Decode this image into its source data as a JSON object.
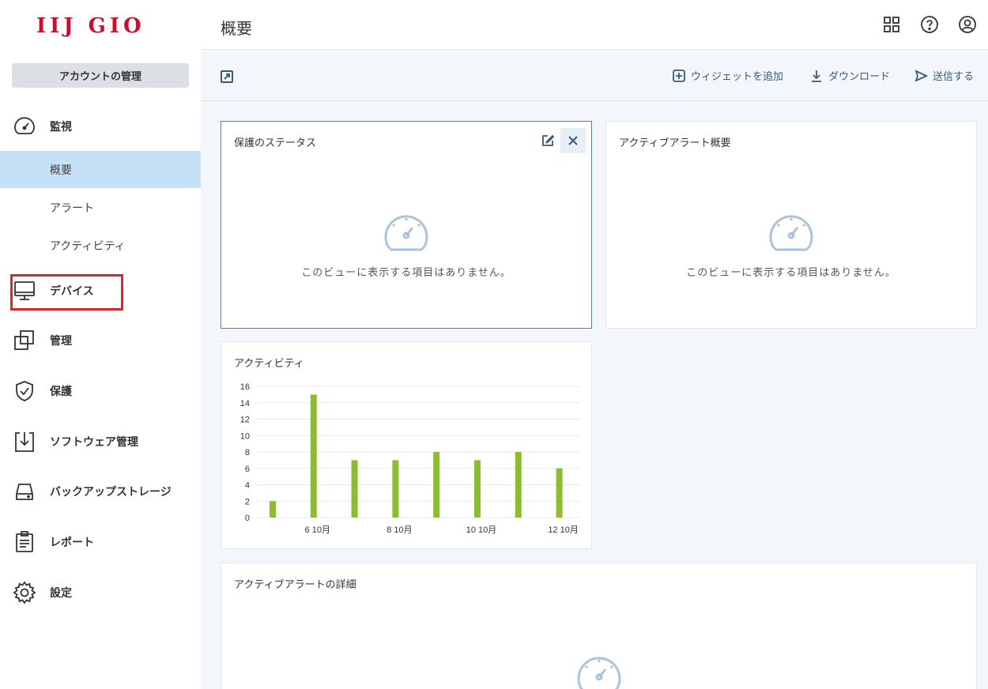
{
  "brand": {
    "logo": "IIJ GIO"
  },
  "sidebar": {
    "account_button": "アカウントの管理",
    "monitor": "監視",
    "sub_items": [
      "概要",
      "アラート",
      "アクティビティ"
    ],
    "devices": "デバイス",
    "management": "管理",
    "protection": "保護",
    "software": "ソフトウェア管理",
    "backup": "バックアップストレージ",
    "reports": "レポート",
    "settings": "設定"
  },
  "header": {
    "title": "概要"
  },
  "toolbar": {
    "add_widget": "ウィジェットを追加",
    "download": "ダウンロード",
    "send": "送信する"
  },
  "widgets": {
    "protection_status": {
      "title": "保護のステータス",
      "empty": "このビューに表示する項目はありません。"
    },
    "active_alerts_summary": {
      "title": "アクティブアラート概要",
      "empty": "このビューに表示する項目はありません。"
    },
    "activity": {
      "title": "アクティビティ"
    },
    "active_alerts_detail": {
      "title": "アクティブアラートの詳細"
    }
  },
  "colors": {
    "accent": "#8dbd2f",
    "highlight": "#d8262c",
    "active_bg": "#c5e1f5"
  },
  "chart_data": {
    "type": "bar",
    "categories": [
      "5",
      "6",
      "7",
      "8",
      "9",
      "10",
      "11",
      "12"
    ],
    "values": [
      2,
      15,
      7,
      7,
      8,
      7,
      8,
      6
    ],
    "x_tick_labels": [
      "6 10月",
      "8 10月",
      "10 10月",
      "12 10月"
    ],
    "y_ticks": [
      0,
      2,
      4,
      6,
      8,
      10,
      12,
      14,
      16
    ],
    "ylim": [
      0,
      16
    ],
    "grid": true,
    "title": "アクティビティ"
  }
}
